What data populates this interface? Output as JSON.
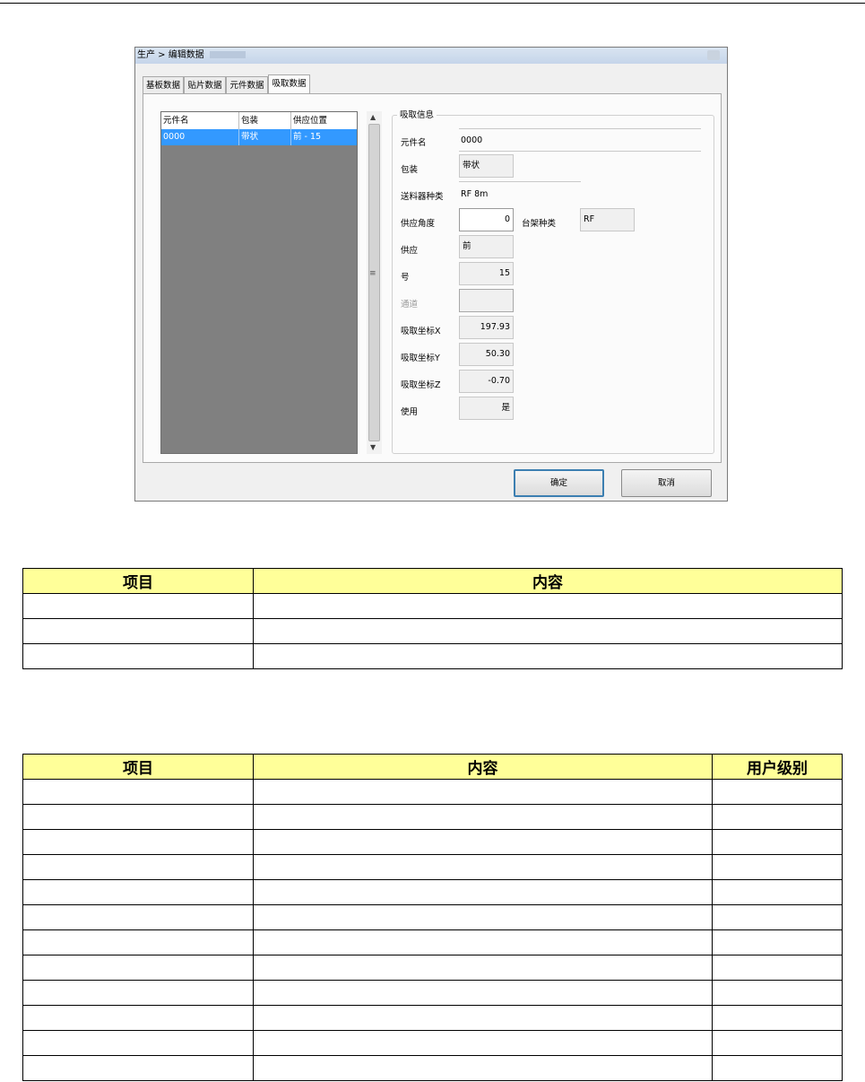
{
  "dialog": {
    "title": "生产 > 编辑数据",
    "tabs": [
      "基板数据",
      "贴片数据",
      "元件数据",
      "吸取数据"
    ],
    "active_tab": "吸取数据",
    "list": {
      "columns": [
        "元件名",
        "包装",
        "供应位置"
      ],
      "rows": [
        [
          "0000",
          "带状",
          "前 - 15"
        ]
      ]
    },
    "group_title": "吸取信息",
    "fields": {
      "part_name": {
        "label": "元件名",
        "value": "0000"
      },
      "packaging": {
        "label": "包装",
        "value": "带状"
      },
      "feeder_type": {
        "label": "送料器种类",
        "value": "RF 8m"
      },
      "supply_angle": {
        "label": "供应角度",
        "value": "0"
      },
      "cart_type": {
        "label": "台架种类",
        "value": "RF"
      },
      "supply": {
        "label": "供应",
        "value": "前"
      },
      "number": {
        "label": "号",
        "value": "15"
      },
      "track": {
        "label": "通道",
        "value": ""
      },
      "pick_x": {
        "label": "吸取坐标X",
        "value": "197.93"
      },
      "pick_y": {
        "label": "吸取坐标Y",
        "value": "50.30"
      },
      "pick_z": {
        "label": "吸取坐标Z",
        "value": "-0.70"
      },
      "use": {
        "label": "使用",
        "value": "是"
      }
    },
    "buttons": {
      "ok": "确定",
      "cancel": "取消"
    }
  },
  "table1": {
    "headers": [
      "项目",
      "内容"
    ],
    "row_count": 3
  },
  "table2": {
    "headers": [
      "项目",
      "内容",
      "用户级别"
    ],
    "row_count": 12
  }
}
